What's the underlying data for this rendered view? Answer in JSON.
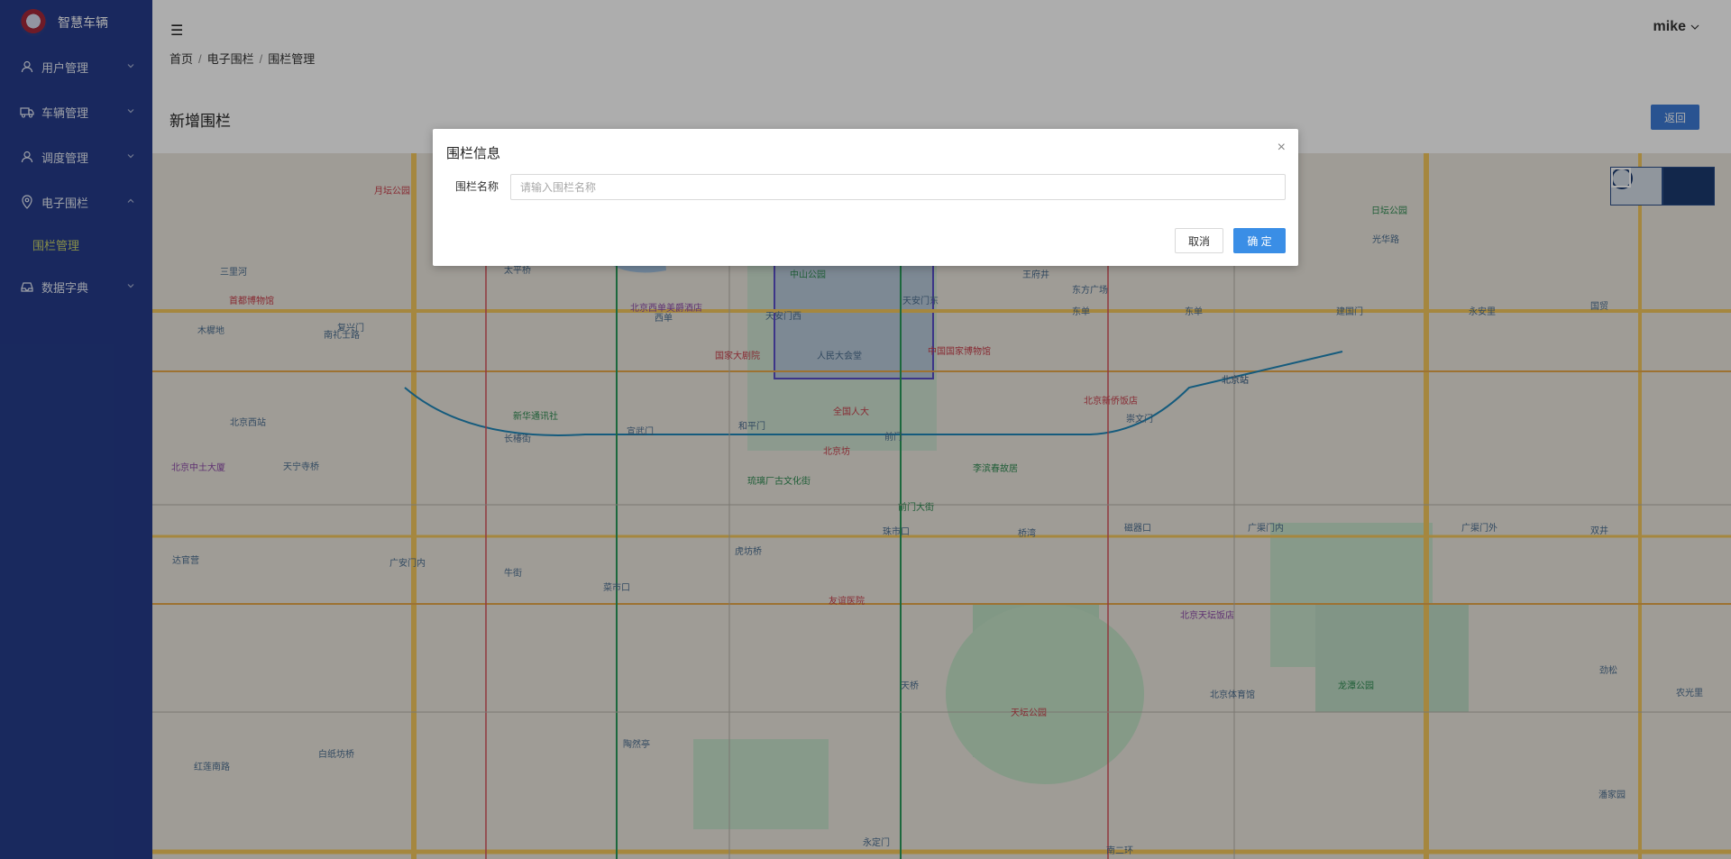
{
  "app": {
    "name": "智慧车辆"
  },
  "sidebar": {
    "items": [
      {
        "label": "用户管理",
        "icon": "user-icon"
      },
      {
        "label": "车辆管理",
        "icon": "truck-icon"
      },
      {
        "label": "调度管理",
        "icon": "user-icon"
      },
      {
        "label": "电子围栏",
        "icon": "location-icon",
        "expanded": true
      },
      {
        "label": "数据字典",
        "icon": "database-icon"
      }
    ],
    "submenu": {
      "label": "围栏管理",
      "active_color": "#c9d36a"
    }
  },
  "header": {
    "user": "mike"
  },
  "breadcrumb": {
    "items": [
      "首页",
      "电子围栏",
      "围栏管理"
    ]
  },
  "page": {
    "title": "新增围栏",
    "back_label": "返回"
  },
  "map": {
    "labels": [
      "首都博物馆",
      "北京西单美爵酒店",
      "新华通讯社",
      "国家大剧院",
      "人民大会堂",
      "天安门西",
      "天安门东",
      "中山公园",
      "全国人大",
      "中国国家博物馆",
      "王府井",
      "东方广场",
      "北京站",
      "北京新侨饭店",
      "崇文门",
      "北京坊",
      "前门",
      "前门大街",
      "李滨春故居",
      "琉璃厂古文化街",
      "珠市口",
      "虎坊桥",
      "天坛公园",
      "天桥",
      "友谊医院",
      "北京天坛饭店",
      "北京体育馆",
      "龙潭公园",
      "陶然亭",
      "宣武门",
      "和平门",
      "长椿街",
      "复兴门",
      "太平桥",
      "西单",
      "东单",
      "建国门",
      "永安里",
      "国贸",
      "广渠门内",
      "双井",
      "磁器口",
      "桥湾",
      "天宁寺桥",
      "北京西站",
      "红莲南路",
      "白纸坊桥",
      "牛街",
      "广安门内",
      "菜市口",
      "南礼士路",
      "三里河",
      "木樨地",
      "月坛公园",
      "北京中土大厦",
      "达官营",
      "日坛公园",
      "光华路",
      "东单",
      "北京站",
      "广渠门外",
      "劲松",
      "农光里",
      "潘家园",
      "永定门",
      "南二环"
    ]
  },
  "modal": {
    "title": "围栏信息",
    "field_label": "围栏名称",
    "placeholder": "请输入围栏名称",
    "cancel_label": "取消",
    "ok_label": "确 定"
  }
}
